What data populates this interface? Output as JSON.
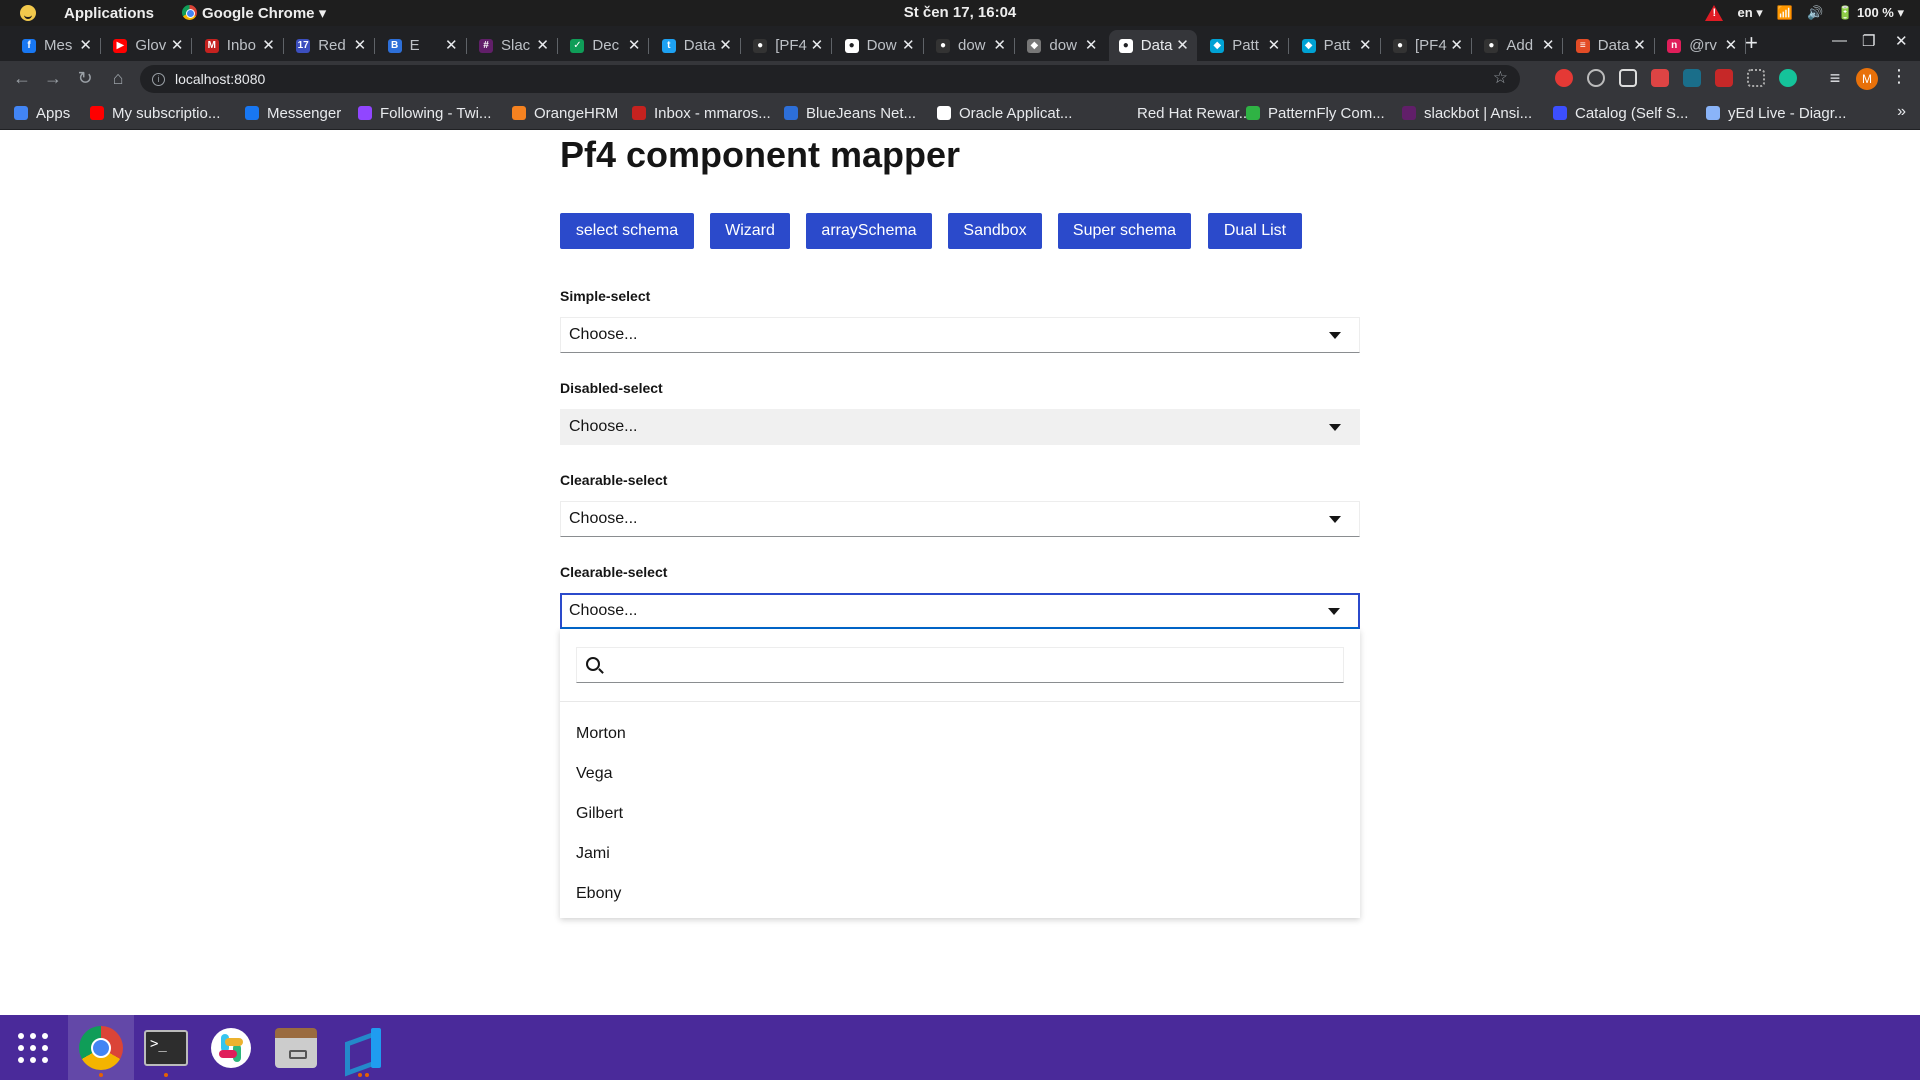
{
  "system_bar": {
    "apps_label": "Applications",
    "active_app": "Google Chrome",
    "clock": "St čen 17, 16:04",
    "lang": "en",
    "battery": "100 %"
  },
  "tabs": [
    {
      "label": "Mes",
      "color": "#1877f2",
      "glyph": "f"
    },
    {
      "label": "Glov",
      "color": "#ff0000",
      "glyph": "▶"
    },
    {
      "label": "Inbo",
      "color": "#c5221f",
      "glyph": "M"
    },
    {
      "label": "Red",
      "color": "#3c4fbf",
      "glyph": "17"
    },
    {
      "label": "E",
      "color": "#2d6fd8",
      "glyph": "B"
    },
    {
      "label": "Slac",
      "color": "#611f69",
      "glyph": "#"
    },
    {
      "label": "Dec",
      "color": "#0f9d58",
      "glyph": "✓"
    },
    {
      "label": "Data",
      "color": "#1da1f2",
      "glyph": "t"
    },
    {
      "label": "[PF4",
      "color": "#333333",
      "glyph": "●"
    },
    {
      "label": "Dow",
      "color": "#ffffff",
      "glyph": "●"
    },
    {
      "label": "dow",
      "color": "#333333",
      "glyph": "●"
    },
    {
      "label": "dow",
      "color": "#777777",
      "glyph": "◆"
    },
    {
      "label": "Data",
      "color": "#ffffff",
      "glyph": "●"
    },
    {
      "label": "Patt",
      "color": "#00a2d4",
      "glyph": "◆"
    },
    {
      "label": "Patt",
      "color": "#00a2d4",
      "glyph": "◆"
    },
    {
      "label": "[PF4",
      "color": "#333333",
      "glyph": "●"
    },
    {
      "label": "Add",
      "color": "#333333",
      "glyph": "●"
    },
    {
      "label": "Data",
      "color": "#e34c26",
      "glyph": "≡"
    },
    {
      "label": "@rv",
      "color": "#e01e5a",
      "glyph": "n"
    }
  ],
  "active_tab_index": 12,
  "omnibox": {
    "url": "localhost:8080"
  },
  "bookmarks": [
    {
      "label": "Apps",
      "color": "#4285f4"
    },
    {
      "label": "My subscriptio...",
      "color": "#ff0000"
    },
    {
      "label": "Messenger",
      "color": "#1877f2"
    },
    {
      "label": "Following - Twi...",
      "color": "#9146ff"
    },
    {
      "label": "OrangeHRM",
      "color": "#f58220"
    },
    {
      "label": "Inbox - mmaros...",
      "color": "#c5221f"
    },
    {
      "label": "BlueJeans Net...",
      "color": "#2d6fd8"
    },
    {
      "label": "Oracle Applicat...",
      "color": "#ffffff"
    },
    {
      "label": "Red Hat Rewar...",
      "color": "#35363a"
    },
    {
      "label": "PatternFly Com...",
      "color": "#2fb344"
    },
    {
      "label": "slackbot | Ansi...",
      "color": "#611f69"
    },
    {
      "label": "Catalog (Self S...",
      "color": "#3c4fff"
    },
    {
      "label": "yEd Live - Diagr...",
      "color": "#8ab4f8"
    }
  ],
  "page": {
    "title": "Pf4 component mapper",
    "nav_buttons": [
      "select schema",
      "Wizard",
      "arraySchema",
      "Sandbox",
      "Super schema",
      "Dual List"
    ],
    "fields": [
      {
        "label": "Simple-select",
        "placeholder": "Choose...",
        "state": "default"
      },
      {
        "label": "Disabled-select",
        "placeholder": "Choose...",
        "state": "disabled"
      },
      {
        "label": "Clearable-select",
        "placeholder": "Choose...",
        "state": "default"
      },
      {
        "label": "Clearable-select",
        "placeholder": "Choose...",
        "state": "open"
      }
    ],
    "dropdown": {
      "search_value": "",
      "options": [
        "Morton",
        "Vega",
        "Gilbert",
        "Jami",
        "Ebony"
      ]
    }
  },
  "dock": {
    "items": [
      "apps-grid",
      "google-chrome",
      "terminal",
      "slack",
      "files",
      "vscode"
    ]
  }
}
